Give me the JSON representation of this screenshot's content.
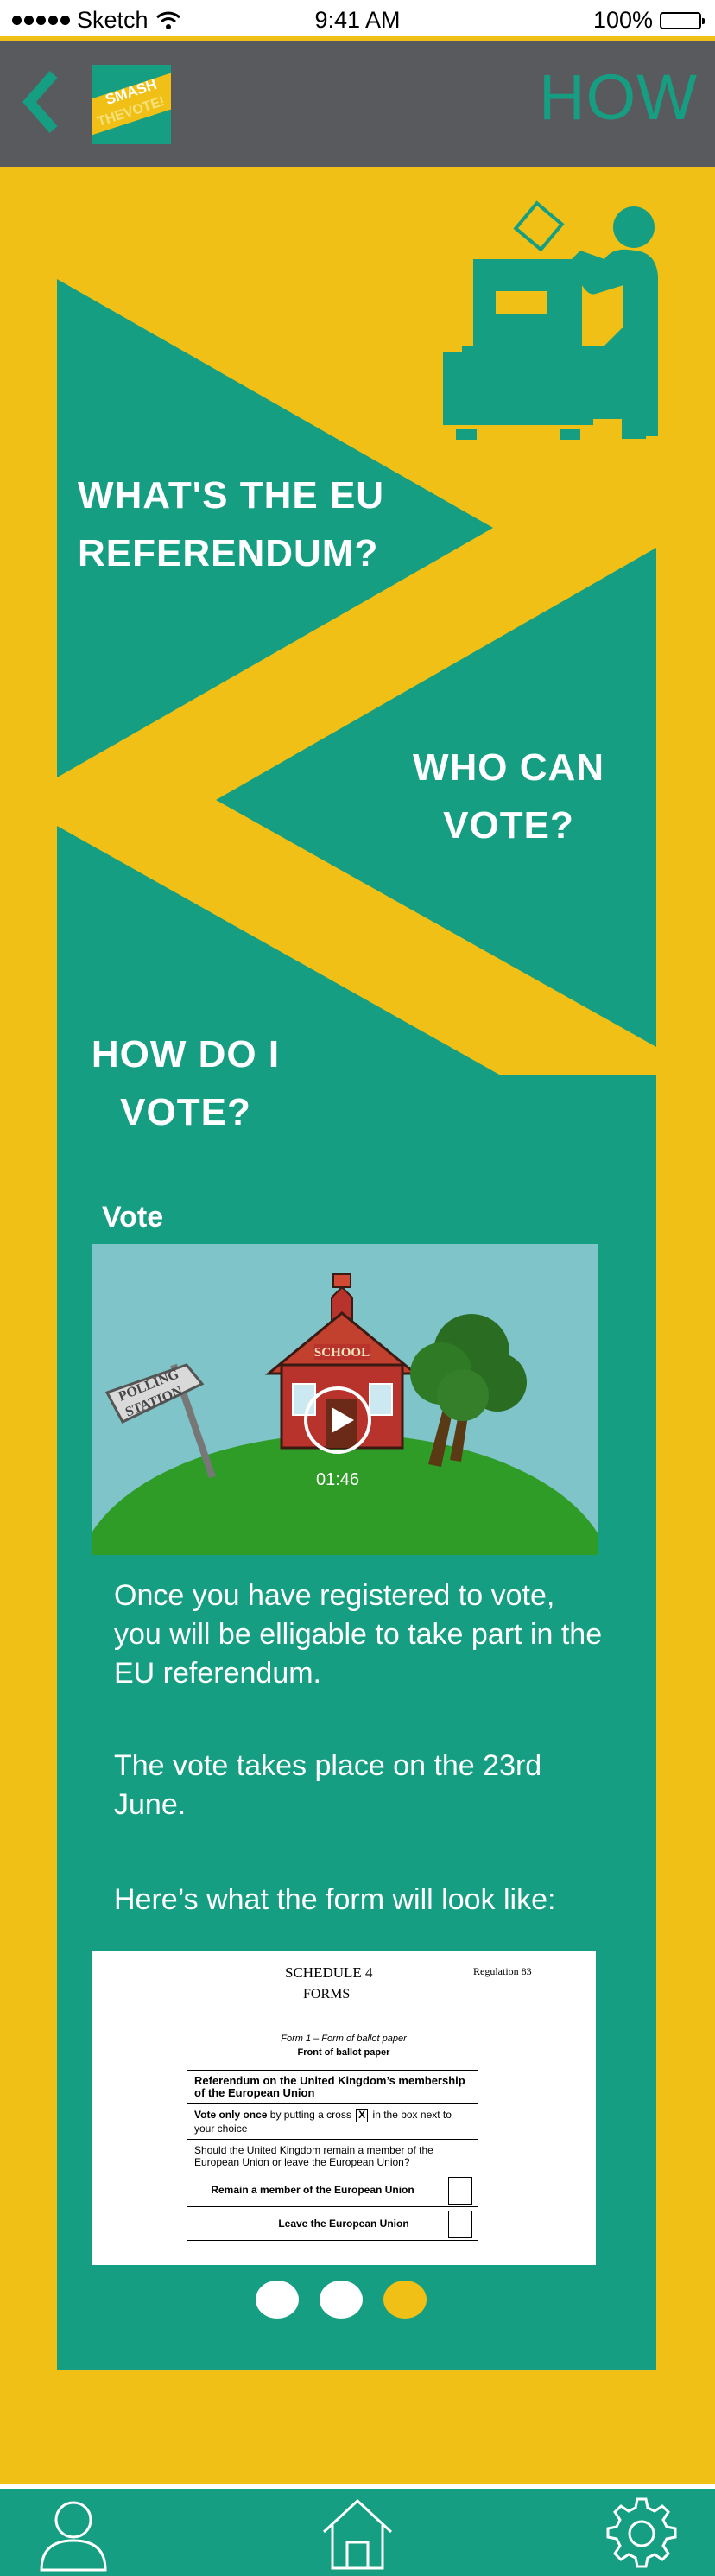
{
  "status_bar": {
    "carrier": "Sketch",
    "time": "9:41 AM",
    "battery": "100%",
    "icons": [
      "signal-dots-icon",
      "wifi-icon",
      "battery-icon"
    ]
  },
  "header": {
    "back_icon": "chevron-left-icon",
    "logo_line1": "SMASH",
    "logo_line2": "THEVOTE!",
    "title": "HOW"
  },
  "nav": {
    "what": [
      "WHAT'S THE EU",
      "REFERENDUM?"
    ],
    "who": [
      "WHO CAN",
      "VOTE?"
    ],
    "how": [
      "HOW DO I",
      "VOTE?"
    ]
  },
  "video": {
    "title": "Vote",
    "duration": "01:46",
    "sign_line1": "POLLING",
    "sign_line2": "STATION",
    "school_sign": "SCHOOL",
    "icon": "play-icon"
  },
  "content": {
    "para1": "Once you have registered to vote, you will be elligable to take part in the EU referendum.",
    "para2": "The vote takes place on the 23rd June.",
    "para3": "Here’s what the form will look like:"
  },
  "ballot": {
    "schedule": "SCHEDULE 4",
    "forms": "FORMS",
    "regulation": "Regulation 83",
    "form_caption": "Form 1 – Form of ballot paper",
    "front": "Front of ballot paper",
    "heading": "Referendum on the United Kingdom’s membership of the European Union",
    "instruction_bold": "Vote only once",
    "instruction_mid": " by putting a cross ",
    "instruction_x": "X",
    "instruction_rest": " in the box next to your choice",
    "question": "Should the United Kingdom remain a member of the European Union or leave the European Union?",
    "option_remain": "Remain a member of the European Union",
    "option_leave": "Leave the European Union"
  },
  "carousel": {
    "pages": 3,
    "active_index": 2
  },
  "tabbar": {
    "icons": [
      "profile-icon",
      "home-icon",
      "settings-gear-icon"
    ]
  },
  "colors": {
    "teal": "#169e82",
    "yellow": "#f0c016",
    "header_grey": "#595a5e",
    "white": "#ffffff"
  }
}
